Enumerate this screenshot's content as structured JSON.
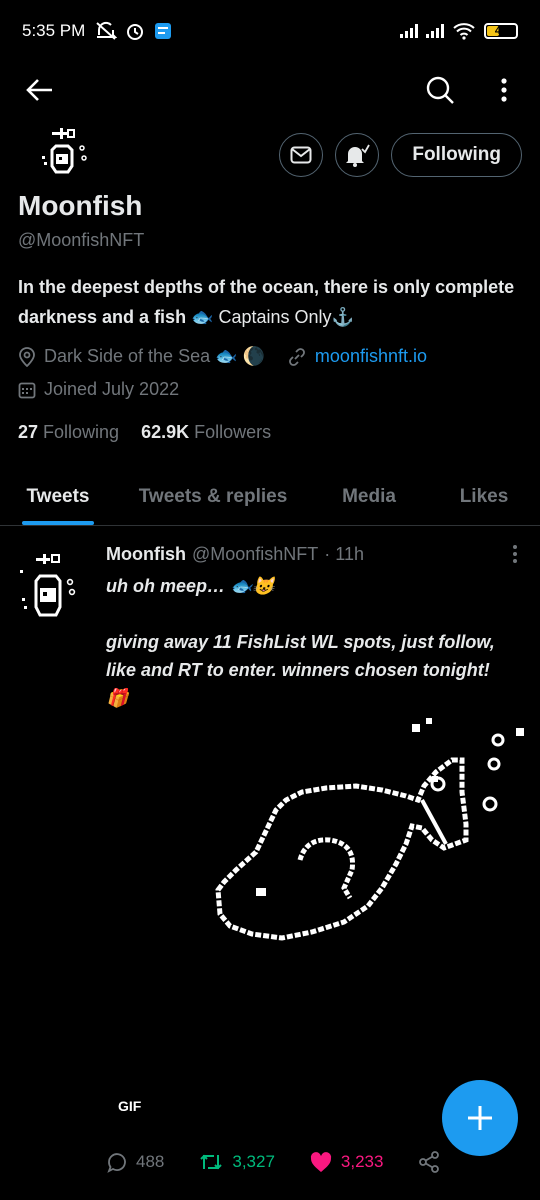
{
  "status_bar": {
    "time": "5:35 PM",
    "battery": "40",
    "icons": [
      "mute-vibrate-icon",
      "alarm-icon",
      "app-notification-icon",
      "signal-icon",
      "signal-icon",
      "wifi-icon",
      "battery-icon"
    ]
  },
  "topbar": {
    "icons": [
      "back-arrow-icon",
      "search-icon",
      "more-vertical-icon"
    ]
  },
  "profile": {
    "name": "Moonfish",
    "handle": "@MoonfishNFT",
    "bio_bold": "In the deepest depths of the ocean, there is only complete darkness and a fish 🐟",
    "bio_plain": " Captains Only⚓",
    "location": "Dark Side of the Sea 🐟 🌘",
    "website": "moonfishnft.io",
    "joined": "Joined July 2022",
    "following_count": "27",
    "following_label": "Following",
    "followers_count": "62.9K",
    "followers_label": "Followers",
    "follow_button": "Following"
  },
  "tabs": [
    {
      "label": "Tweets",
      "active": true
    },
    {
      "label": "Tweets & replies",
      "active": false
    },
    {
      "label": "Media",
      "active": false
    },
    {
      "label": "Likes",
      "active": false
    }
  ],
  "tweet": {
    "author": "Moonfish",
    "handle": "@MoonfishNFT",
    "time": "· 11h",
    "line1": "uh oh meep… 🐟😺",
    "line2": "giving away 11 FishList WL spots, just follow, like and RT to enter. winners chosen tonight! 🎁",
    "media_badge": "GIF",
    "replies": "488",
    "retweets": "3,327",
    "likes": "3,233"
  },
  "colors": {
    "accent": "#1d9bf0",
    "retweet": "#00ba7c",
    "like": "#f91880",
    "muted": "#71767b"
  }
}
